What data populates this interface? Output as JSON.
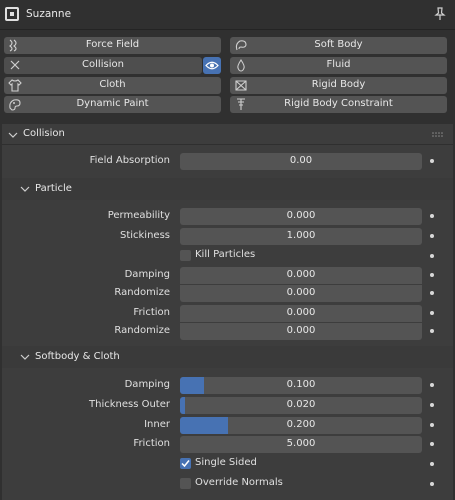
{
  "header": {
    "object_name": "Suzanne"
  },
  "physics_buttons": {
    "force_field": "Force Field",
    "soft_body": "Soft Body",
    "collision": "Collision",
    "fluid": "Fluid",
    "cloth": "Cloth",
    "rigid_body": "Rigid Body",
    "dynamic_paint": "Dynamic Paint",
    "rigid_body_constraint": "Rigid Body Constraint"
  },
  "collision_panel": {
    "title": "Collision",
    "field_absorption": {
      "label": "Field Absorption",
      "value": "0.00"
    },
    "particle": {
      "title": "Particle",
      "permeability": {
        "label": "Permeability",
        "value": "0.000"
      },
      "stickiness": {
        "label": "Stickiness",
        "value": "1.000"
      },
      "kill_particles": {
        "label": "Kill Particles",
        "checked": false
      },
      "damping": {
        "label": "Damping",
        "value": "0.000"
      },
      "damping_randomize": {
        "label": "Randomize",
        "value": "0.000"
      },
      "friction": {
        "label": "Friction",
        "value": "0.000"
      },
      "friction_randomize": {
        "label": "Randomize",
        "value": "0.000"
      }
    },
    "softbody_cloth": {
      "title": "Softbody & Cloth",
      "damping": {
        "label": "Damping",
        "value": "0.100",
        "fraction": 0.1
      },
      "thickness_outer": {
        "label": "Thickness Outer",
        "value": "0.020",
        "fraction": 0.02
      },
      "inner": {
        "label": "Inner",
        "value": "0.200",
        "fraction": 0.2
      },
      "friction": {
        "label": "Friction",
        "value": "5.000",
        "fraction": 0
      },
      "single_sided": {
        "label": "Single Sided",
        "checked": true
      },
      "override_normals": {
        "label": "Override Normals",
        "checked": false
      }
    }
  },
  "colors": {
    "accent": "#4772b3",
    "panel": "#3d3d3d",
    "field": "#545454"
  }
}
